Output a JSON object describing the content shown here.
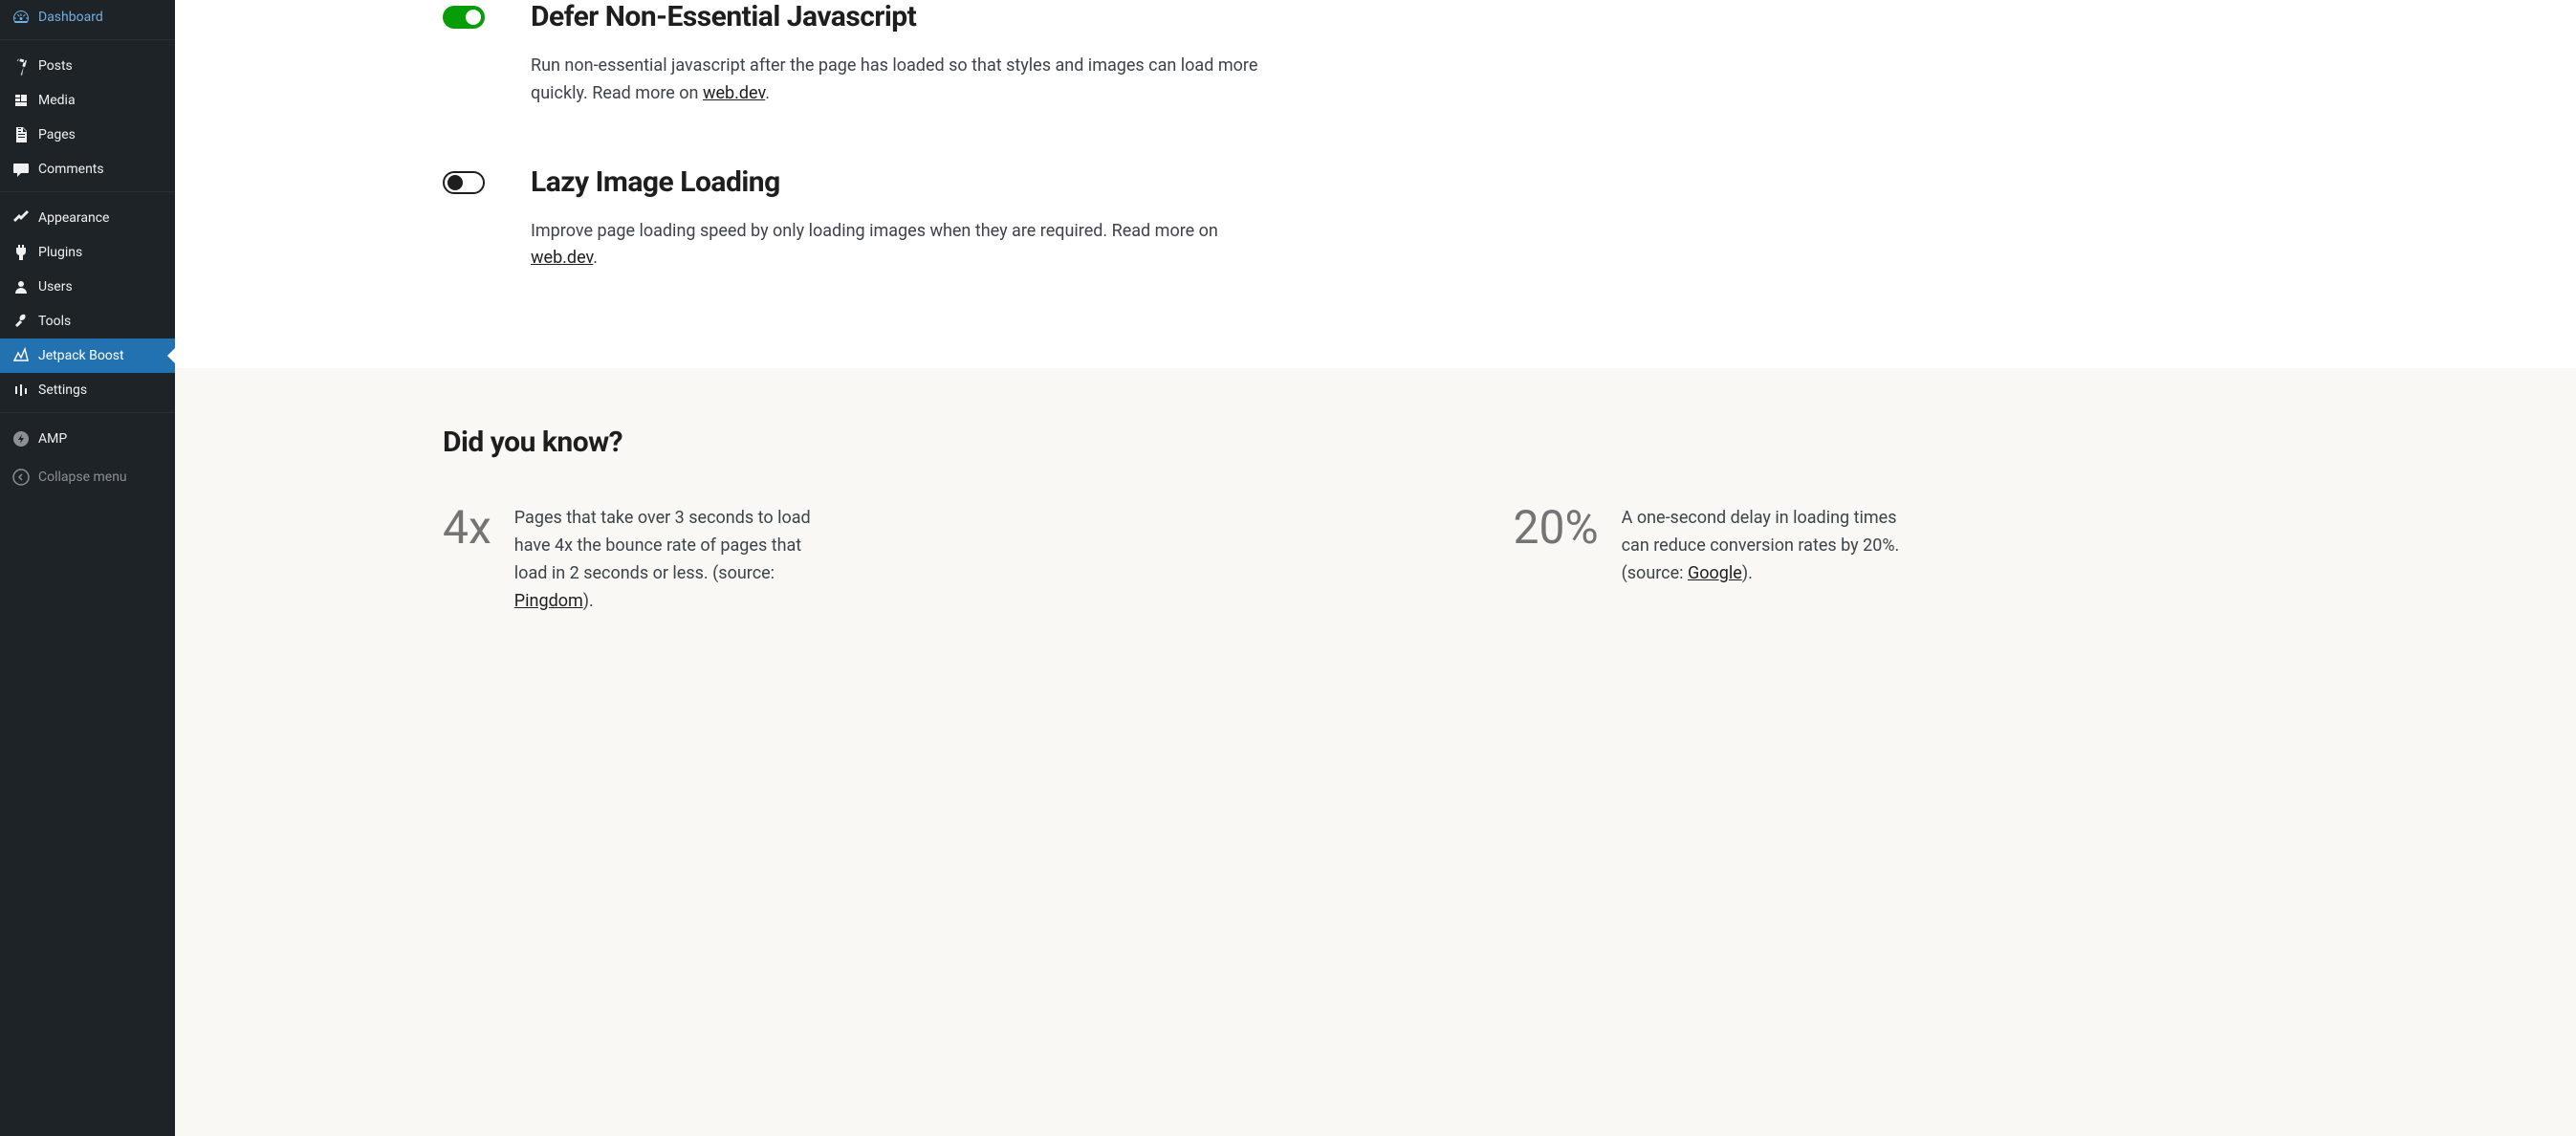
{
  "sidebar": {
    "items": [
      {
        "label": "Dashboard",
        "icon": "dashboard"
      },
      {
        "label": "Posts",
        "icon": "pin"
      },
      {
        "label": "Media",
        "icon": "media"
      },
      {
        "label": "Pages",
        "icon": "pages"
      },
      {
        "label": "Comments",
        "icon": "comments"
      },
      {
        "label": "Appearance",
        "icon": "appearance"
      },
      {
        "label": "Plugins",
        "icon": "plugins"
      },
      {
        "label": "Users",
        "icon": "users"
      },
      {
        "label": "Tools",
        "icon": "tools"
      },
      {
        "label": "Jetpack Boost",
        "icon": "boost"
      },
      {
        "label": "Settings",
        "icon": "settings"
      },
      {
        "label": "AMP",
        "icon": "amp"
      },
      {
        "label": "Collapse menu",
        "icon": "collapse"
      }
    ]
  },
  "settings": [
    {
      "title": "Defer Non-Essential Javascript",
      "description_before_link": "Run non-essential javascript after the page has loaded so that styles and images can load more quickly. Read more on ",
      "link_text": "web.dev",
      "description_after_link": ".",
      "enabled": true
    },
    {
      "title": "Lazy Image Loading",
      "description_before_link": "Improve page loading speed by only loading images when they are required. Read more on ",
      "link_text": "web.dev",
      "description_after_link": ".",
      "enabled": false
    }
  ],
  "footer": {
    "title": "Did you know?",
    "facts": [
      {
        "number": "4x",
        "text_before_link": "Pages that take over 3 seconds to load have 4x the bounce rate of pages that load in 2 seconds or less. (source: ",
        "link_text": "Pingdom",
        "text_after_link": ")."
      },
      {
        "number": "20%",
        "text_before_link": "A one-second delay in loading times can reduce conversion rates by 20%. (source: ",
        "link_text": "Google",
        "text_after_link": ")."
      }
    ]
  }
}
